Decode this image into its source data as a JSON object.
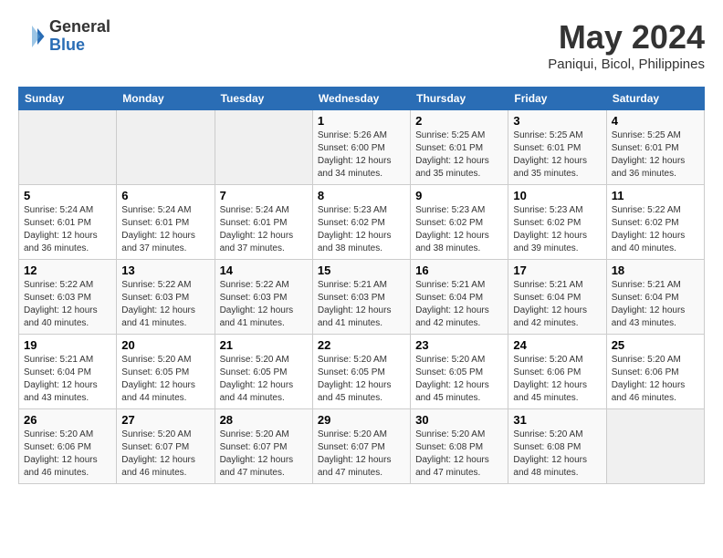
{
  "header": {
    "logo_general": "General",
    "logo_blue": "Blue",
    "month": "May 2024",
    "location": "Paniqui, Bicol, Philippines"
  },
  "days_of_week": [
    "Sunday",
    "Monday",
    "Tuesday",
    "Wednesday",
    "Thursday",
    "Friday",
    "Saturday"
  ],
  "weeks": [
    [
      {
        "day": "",
        "info": ""
      },
      {
        "day": "",
        "info": ""
      },
      {
        "day": "",
        "info": ""
      },
      {
        "day": "1",
        "info": "Sunrise: 5:26 AM\nSunset: 6:00 PM\nDaylight: 12 hours and 34 minutes."
      },
      {
        "day": "2",
        "info": "Sunrise: 5:25 AM\nSunset: 6:01 PM\nDaylight: 12 hours and 35 minutes."
      },
      {
        "day": "3",
        "info": "Sunrise: 5:25 AM\nSunset: 6:01 PM\nDaylight: 12 hours and 35 minutes."
      },
      {
        "day": "4",
        "info": "Sunrise: 5:25 AM\nSunset: 6:01 PM\nDaylight: 12 hours and 36 minutes."
      }
    ],
    [
      {
        "day": "5",
        "info": "Sunrise: 5:24 AM\nSunset: 6:01 PM\nDaylight: 12 hours and 36 minutes."
      },
      {
        "day": "6",
        "info": "Sunrise: 5:24 AM\nSunset: 6:01 PM\nDaylight: 12 hours and 37 minutes."
      },
      {
        "day": "7",
        "info": "Sunrise: 5:24 AM\nSunset: 6:01 PM\nDaylight: 12 hours and 37 minutes."
      },
      {
        "day": "8",
        "info": "Sunrise: 5:23 AM\nSunset: 6:02 PM\nDaylight: 12 hours and 38 minutes."
      },
      {
        "day": "9",
        "info": "Sunrise: 5:23 AM\nSunset: 6:02 PM\nDaylight: 12 hours and 38 minutes."
      },
      {
        "day": "10",
        "info": "Sunrise: 5:23 AM\nSunset: 6:02 PM\nDaylight: 12 hours and 39 minutes."
      },
      {
        "day": "11",
        "info": "Sunrise: 5:22 AM\nSunset: 6:02 PM\nDaylight: 12 hours and 40 minutes."
      }
    ],
    [
      {
        "day": "12",
        "info": "Sunrise: 5:22 AM\nSunset: 6:03 PM\nDaylight: 12 hours and 40 minutes."
      },
      {
        "day": "13",
        "info": "Sunrise: 5:22 AM\nSunset: 6:03 PM\nDaylight: 12 hours and 41 minutes."
      },
      {
        "day": "14",
        "info": "Sunrise: 5:22 AM\nSunset: 6:03 PM\nDaylight: 12 hours and 41 minutes."
      },
      {
        "day": "15",
        "info": "Sunrise: 5:21 AM\nSunset: 6:03 PM\nDaylight: 12 hours and 41 minutes."
      },
      {
        "day": "16",
        "info": "Sunrise: 5:21 AM\nSunset: 6:04 PM\nDaylight: 12 hours and 42 minutes."
      },
      {
        "day": "17",
        "info": "Sunrise: 5:21 AM\nSunset: 6:04 PM\nDaylight: 12 hours and 42 minutes."
      },
      {
        "day": "18",
        "info": "Sunrise: 5:21 AM\nSunset: 6:04 PM\nDaylight: 12 hours and 43 minutes."
      }
    ],
    [
      {
        "day": "19",
        "info": "Sunrise: 5:21 AM\nSunset: 6:04 PM\nDaylight: 12 hours and 43 minutes."
      },
      {
        "day": "20",
        "info": "Sunrise: 5:20 AM\nSunset: 6:05 PM\nDaylight: 12 hours and 44 minutes."
      },
      {
        "day": "21",
        "info": "Sunrise: 5:20 AM\nSunset: 6:05 PM\nDaylight: 12 hours and 44 minutes."
      },
      {
        "day": "22",
        "info": "Sunrise: 5:20 AM\nSunset: 6:05 PM\nDaylight: 12 hours and 45 minutes."
      },
      {
        "day": "23",
        "info": "Sunrise: 5:20 AM\nSunset: 6:05 PM\nDaylight: 12 hours and 45 minutes."
      },
      {
        "day": "24",
        "info": "Sunrise: 5:20 AM\nSunset: 6:06 PM\nDaylight: 12 hours and 45 minutes."
      },
      {
        "day": "25",
        "info": "Sunrise: 5:20 AM\nSunset: 6:06 PM\nDaylight: 12 hours and 46 minutes."
      }
    ],
    [
      {
        "day": "26",
        "info": "Sunrise: 5:20 AM\nSunset: 6:06 PM\nDaylight: 12 hours and 46 minutes."
      },
      {
        "day": "27",
        "info": "Sunrise: 5:20 AM\nSunset: 6:07 PM\nDaylight: 12 hours and 46 minutes."
      },
      {
        "day": "28",
        "info": "Sunrise: 5:20 AM\nSunset: 6:07 PM\nDaylight: 12 hours and 47 minutes."
      },
      {
        "day": "29",
        "info": "Sunrise: 5:20 AM\nSunset: 6:07 PM\nDaylight: 12 hours and 47 minutes."
      },
      {
        "day": "30",
        "info": "Sunrise: 5:20 AM\nSunset: 6:08 PM\nDaylight: 12 hours and 47 minutes."
      },
      {
        "day": "31",
        "info": "Sunrise: 5:20 AM\nSunset: 6:08 PM\nDaylight: 12 hours and 48 minutes."
      },
      {
        "day": "",
        "info": ""
      }
    ]
  ]
}
